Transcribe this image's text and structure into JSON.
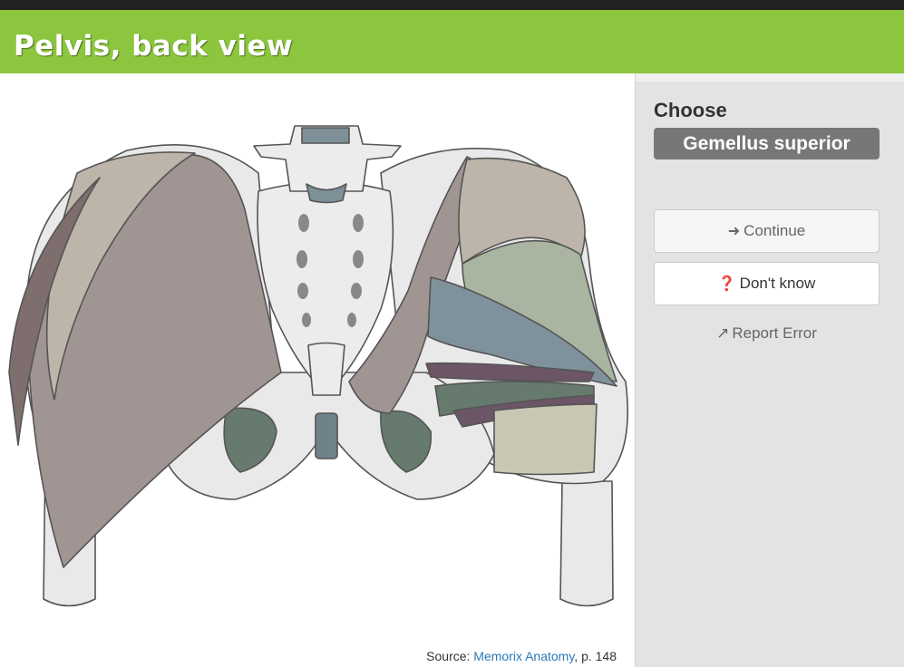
{
  "header": {
    "title": "Pelvis, back view"
  },
  "sidebar": {
    "choose_label": "Choose",
    "target_term": "Gemellus superior",
    "continue_label": "Continue",
    "continue_icon": "arrow-right-icon",
    "dont_know_label": "Don't know",
    "dont_know_icon": "question-circle-icon",
    "report_label": "Report Error",
    "report_icon": "external-link-icon"
  },
  "source": {
    "prefix": "Source: ",
    "link_text": "Memorix Anatomy",
    "suffix": ", p. 148"
  },
  "colors": {
    "header_bg": "#8cc63f",
    "topbar_bg": "#222222",
    "sidebar_bg": "#e3e3e3",
    "target_bg": "#777777",
    "link": "#2a78b9"
  }
}
